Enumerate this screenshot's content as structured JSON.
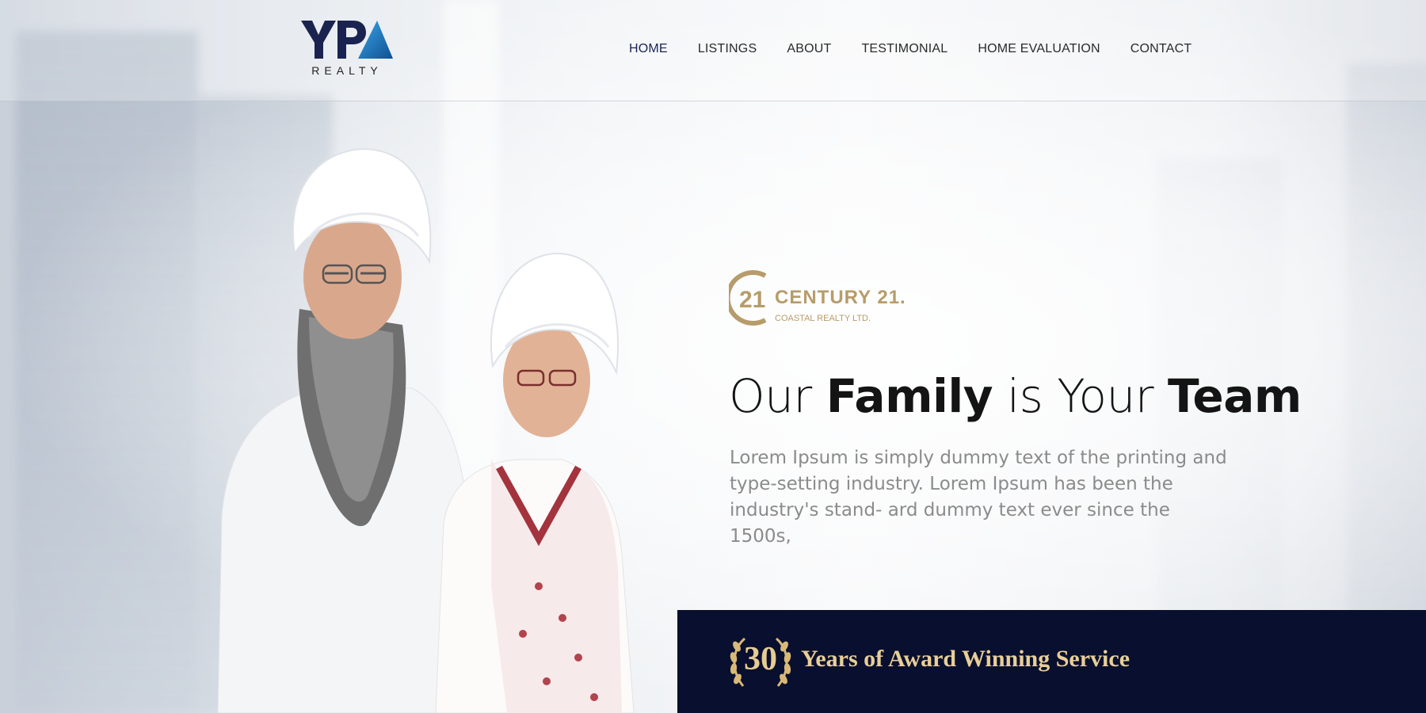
{
  "brand": {
    "logo_letters": "YPA",
    "logo_subtitle": "REALTY",
    "colors": {
      "navy": "#1a2350",
      "accent_blue": "#1e7fc1",
      "gold": "#b79c6b",
      "banner_bg": "#090f2e"
    }
  },
  "nav": {
    "items": [
      {
        "label": "HOME",
        "active": true
      },
      {
        "label": "LISTINGS"
      },
      {
        "label": "ABOUT"
      },
      {
        "label": "TESTIMONIAL"
      },
      {
        "label": "HOME EVALUATION"
      },
      {
        "label": "CONTACT"
      }
    ]
  },
  "hero": {
    "partner_mark": "21",
    "partner_name": "CENTURY 21.",
    "partner_sub": "COASTAL REALTY LTD.",
    "headline": {
      "w1": "Our",
      "w2": "Family",
      "w3": "is Your",
      "w4": "Team"
    },
    "lede": "Lorem Ipsum is simply dummy text of the printing and type-setting industry. Lorem Ipsum has been the industry's stand- ard dummy text ever since the 1500s,",
    "photo_icon": "family-photo"
  },
  "banner": {
    "years": "30",
    "text": "Years of Award Winning Service",
    "laurel_icon": "laurel-wreath-icon"
  }
}
